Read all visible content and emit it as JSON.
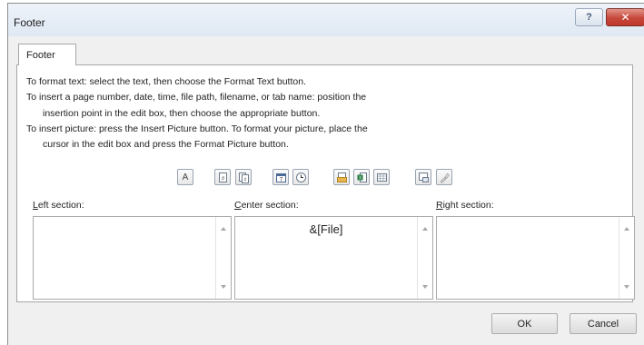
{
  "window": {
    "title": "Footer"
  },
  "titlebar": {
    "help_label": "?",
    "close_label": "✕"
  },
  "tab": {
    "label": "Footer"
  },
  "instructions": [
    "To format text:  select the text, then choose the Format Text button.",
    "To insert a page number, date, time, file path, filename, or tab name:  position the",
    "insertion point in the edit box, then choose the appropriate button.",
    "To insert picture: press the Insert Picture button.  To format your picture, place the",
    "cursor in the edit box and press the Format Picture button."
  ],
  "toolbar": {
    "format_text": {
      "label": "A",
      "icon": "format-text-icon"
    },
    "page_number": {
      "icon": "page-number-icon"
    },
    "number_of_pages": {
      "icon": "number-of-pages-icon"
    },
    "date": {
      "icon": "date-icon"
    },
    "time": {
      "icon": "time-icon"
    },
    "file_path": {
      "icon": "file-path-icon"
    },
    "file_name": {
      "icon": "file-name-icon"
    },
    "sheet_name": {
      "icon": "sheet-name-icon"
    },
    "insert_picture": {
      "icon": "insert-picture-icon"
    },
    "format_picture": {
      "icon": "format-picture-icon"
    }
  },
  "sections": {
    "left": {
      "label_accel": "L",
      "label_rest": "eft section:",
      "value": ""
    },
    "center": {
      "label_accel": "C",
      "label_rest": "enter section:",
      "value": "&[File]"
    },
    "right": {
      "label_accel": "R",
      "label_rest": "ight section:",
      "value": ""
    }
  },
  "buttons": {
    "ok": "OK",
    "cancel": "Cancel"
  },
  "colors": {
    "close_button": "#c6483b",
    "titlebar": "#dfe8f3",
    "dialog_bg": "#f0f0f0"
  }
}
